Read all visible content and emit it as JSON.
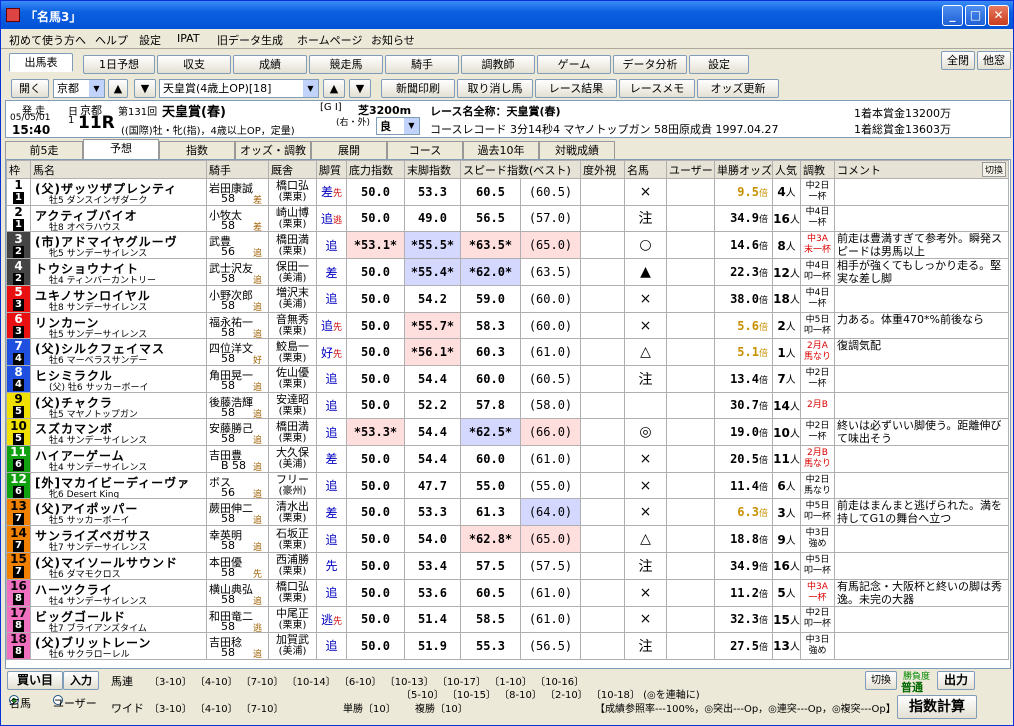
{
  "window": {
    "title": "「名馬3」"
  },
  "menu": [
    "初めて使う方へ",
    "ヘルプ",
    "設定",
    "IPAT",
    "旧データ生成",
    "ホームページ",
    "お知らせ"
  ],
  "main_tabs": [
    "出馬表",
    "1日予想",
    "収支",
    "成績",
    "競走馬",
    "騎手",
    "調教師",
    "ゲーム",
    "データ分析",
    "設定"
  ],
  "right_buttons": [
    "全閉",
    "他窓"
  ],
  "toolbar": {
    "open": "開く",
    "course": "京都",
    "race": "天皇賞(4歳上OP)[18]",
    "buttons": [
      "新聞印刷",
      "取り消し馬",
      "レース結果",
      "レースメモ",
      "オッズ更新"
    ]
  },
  "race_info": {
    "announce": "発 走",
    "date": "05/05/01",
    "time": "15:40",
    "day": "日",
    "place": "京都",
    "day_num": "1",
    "r_num": "11R",
    "kai": "第131回",
    "race_name": "天皇賞(春)",
    "grade": "[G I]",
    "distance": "芝3200m",
    "turn": "(右・外)",
    "going": "良",
    "cond": "((国際)牡・牝(指)，4歳以上OP，定量)",
    "full_label": "レース名全称：天皇賞(春)",
    "record": "コースレコード 3分14秒4 マヤノトップガン 58田原成貴 1997.04.27",
    "prize1": "1着本賞金13200万",
    "prize2": "1着総賞金13603万"
  },
  "sub_tabs": [
    "前5走",
    "予想",
    "指数",
    "オッズ・調教",
    "展開",
    "コース",
    "過去10年",
    "対戦成績"
  ],
  "columns": [
    "枠",
    "馬名",
    "騎手",
    "厩舎",
    "脚質",
    "底力指数",
    "末脚指数",
    "スピード指数(ベスト)",
    "度外視",
    "名馬",
    "ユーザー",
    "単勝オッズ",
    "人気",
    "調教",
    "コメント"
  ],
  "switch_label": "切換",
  "horses": [
    {
      "waku": "1",
      "num": "1",
      "name": "(父)ザッツザプレンティ",
      "sub": "牡5 ダンスインザダーク",
      "jockey": "岩田康誠",
      "weight": "58",
      "jmark": "差",
      "trainer": "橋口弘",
      "region": "(栗東)",
      "leg": "差",
      "legm": "先",
      "base": "50.0",
      "last": "53.3",
      "speed": "60.5",
      "best": "(60.5)",
      "mark": "×",
      "odds": "9.5",
      "oddsGold": true,
      "pop": "4",
      "cond1": "中2日",
      "cond2": "一杯",
      "comment": ""
    },
    {
      "waku": "1",
      "num": "2",
      "name": "アクティブバイオ",
      "sub": "牡8 オペラハウス",
      "jockey": "小牧太",
      "weight": "58",
      "jmark": "差",
      "trainer": "崎山博",
      "region": "(栗東)",
      "leg": "追",
      "legm": "逃",
      "base": "50.0",
      "last": "49.0",
      "speed": "56.5",
      "best": "(57.0)",
      "mark": "注",
      "odds": "34.9",
      "pop": "16",
      "cond1": "中4日",
      "cond2": "一杯",
      "comment": ""
    },
    {
      "waku": "2",
      "num": "3",
      "name": "(市)アドマイヤグルーヴ",
      "sub": "牝5 サンデーサイレンス",
      "jockey": "武豊",
      "weight": "56",
      "jmark": "追",
      "trainer": "橋田満",
      "region": "(栗東)",
      "leg": "追",
      "legm": "",
      "base": "*53.1*",
      "baseHl": "r",
      "last": "*55.5*",
      "lastHl": "b",
      "speed": "*63.5*",
      "speedHl": "r",
      "best": "(65.0)",
      "bestHl": "r",
      "mark": "○",
      "odds": "14.6",
      "pop": "8",
      "cond1": "中3A",
      "cond2": "末一杯",
      "condRed": true,
      "comment": "前走は豊満すぎて参考外。瞬発スピードは男馬以上"
    },
    {
      "waku": "2",
      "num": "4",
      "name": "トウショウナイト",
      "sub": "牡4 ティンバーカントリー",
      "jockey": "武士沢友",
      "weight": "58",
      "jmark": "追",
      "trainer": "保田一",
      "region": "(美浦)",
      "leg": "差",
      "legm": "",
      "base": "50.0",
      "last": "*55.4*",
      "lastHl": "b",
      "speed": "*62.0*",
      "speedHl": "b",
      "best": "(63.5)",
      "mark": "▲",
      "odds": "22.3",
      "pop": "12",
      "cond1": "中4日",
      "cond2": "叩一杯",
      "comment": "相手が強くてもしっかり走る。堅実な差し脚"
    },
    {
      "waku": "3",
      "num": "5",
      "name": "ユキノサンロイヤル",
      "sub": "牡8 サンデーサイレンス",
      "jockey": "小野次郎",
      "weight": "58",
      "jmark": "追",
      "trainer": "増沢末",
      "region": "(美浦)",
      "leg": "追",
      "legm": "",
      "base": "50.0",
      "last": "54.2",
      "speed": "59.0",
      "best": "(60.0)",
      "mark": "×",
      "odds": "38.0",
      "pop": "18",
      "cond1": "中4日",
      "cond2": "一杯",
      "comment": ""
    },
    {
      "waku": "3",
      "num": "6",
      "name": "リンカーン",
      "sub": "牡5 サンデーサイレンス",
      "jockey": "福永祐一",
      "weight": "58",
      "jmark": "追",
      "trainer": "音無秀",
      "region": "(栗東)",
      "leg": "追",
      "legm": "先",
      "base": "50.0",
      "last": "*55.7*",
      "lastHl": "r",
      "speed": "58.3",
      "best": "(60.0)",
      "mark": "×",
      "odds": "5.6",
      "oddsGold": true,
      "pop": "2",
      "cond1": "中5日",
      "cond2": "叩一杯",
      "comment": "力ある。体重470*%前後なら"
    },
    {
      "waku": "4",
      "num": "7",
      "name": "(父)シルクフェイマス",
      "sub": "牡6 マーベラスサンデー",
      "jockey": "四位洋文",
      "weight": "58",
      "jmark": "好",
      "trainer": "鮫島一",
      "region": "(栗東)",
      "leg": "好",
      "legm": "先",
      "base": "50.0",
      "last": "*56.1*",
      "lastHl": "r",
      "speed": "60.3",
      "best": "(61.0)",
      "mark": "△",
      "odds": "5.1",
      "oddsGold": true,
      "pop": "1",
      "cond1": "2月A",
      "cond2": "馬なり",
      "condRed": true,
      "comment": "復調気配"
    },
    {
      "waku": "4",
      "num": "8",
      "name": "ヒシミラクル",
      "sub": "(父) 牡6 サッカーボーイ",
      "jockey": "角田晃一",
      "weight": "58",
      "jmark": "追",
      "trainer": "佐山優",
      "region": "(栗東)",
      "leg": "追",
      "legm": "",
      "base": "50.0",
      "last": "54.4",
      "speed": "60.0",
      "best": "(60.5)",
      "mark": "注",
      "odds": "13.4",
      "pop": "7",
      "cond1": "中2日",
      "cond2": "一杯",
      "comment": ""
    },
    {
      "waku": "5",
      "num": "9",
      "name": "(父)チャクラ",
      "sub": "牡5 マヤノトップガン",
      "jockey": "後藤浩輝",
      "weight": "58",
      "jmark": "追",
      "trainer": "安達昭",
      "region": "(栗東)",
      "leg": "追",
      "legm": "",
      "base": "50.0",
      "last": "52.2",
      "speed": "57.8",
      "best": "(58.0)",
      "mark": "",
      "odds": "30.7",
      "pop": "14",
      "cond1": "2月B",
      "cond2": "",
      "condRed": true,
      "comment": ""
    },
    {
      "waku": "5",
      "num": "10",
      "name": "スズカマンボ",
      "sub": "牡4 サンデーサイレンス",
      "jockey": "安藤勝己",
      "weight": "58",
      "jmark": "追",
      "trainer": "橋田満",
      "region": "(栗東)",
      "leg": "追",
      "legm": "",
      "base": "*53.3*",
      "baseHl": "r",
      "last": "54.4",
      "speed": "*62.5*",
      "speedHl": "b",
      "best": "(66.0)",
      "bestHl": "r",
      "mark": "◎",
      "odds": "19.0",
      "pop": "10",
      "cond1": "中2日",
      "cond2": "一杯",
      "comment": "終いは必ずいい脚使う。距離伸びて味出そう"
    },
    {
      "waku": "6",
      "num": "11",
      "name": "ハイアーゲーム",
      "sub": "牡4 サンデーサイレンス",
      "jockey": "吉田豊",
      "weight": "B 58",
      "jmark": "追",
      "trainer": "大久保",
      "region": "(美浦)",
      "leg": "差",
      "legm": "",
      "base": "50.0",
      "last": "54.4",
      "speed": "60.0",
      "best": "(61.0)",
      "mark": "×",
      "odds": "20.5",
      "pop": "11",
      "cond1": "2月B",
      "cond2": "馬なり",
      "condRed": true,
      "comment": ""
    },
    {
      "waku": "6",
      "num": "12",
      "name": "[外]マカイビーディーヴァ",
      "sub": "牝6 Desert King",
      "jockey": "ボス",
      "weight": "56",
      "jmark": "追",
      "trainer": "フリー",
      "region": "(豪州)",
      "leg": "追",
      "legm": "",
      "base": "50.0",
      "last": "47.7",
      "speed": "55.0",
      "best": "(55.0)",
      "mark": "×",
      "odds": "11.4",
      "pop": "6",
      "cond1": "中2日",
      "cond2": "馬なり",
      "comment": ""
    },
    {
      "waku": "7",
      "num": "13",
      "name": "(父)アイポッパー",
      "sub": "牡5 サッカーボーイ",
      "jockey": "蕨田伸二",
      "weight": "58",
      "jmark": "追",
      "trainer": "清水出",
      "region": "(栗東)",
      "leg": "差",
      "legm": "",
      "base": "50.0",
      "last": "53.3",
      "speed": "61.3",
      "best": "(64.0)",
      "bestHl": "b",
      "mark": "×",
      "odds": "6.3",
      "oddsGold": true,
      "pop": "3",
      "cond1": "中5日",
      "cond2": "叩一杯",
      "comment": "前走はまんまと逃げられた。満を持してG1の舞台へ立つ"
    },
    {
      "waku": "7",
      "num": "14",
      "name": "サンライズペガサス",
      "sub": "牡7 サンデーサイレンス",
      "jockey": "幸英明",
      "weight": "58",
      "jmark": "追",
      "trainer": "石坂正",
      "region": "(栗東)",
      "leg": "追",
      "legm": "",
      "base": "50.0",
      "last": "54.0",
      "speed": "*62.8*",
      "speedHl": "r",
      "best": "(65.0)",
      "bestHl": "r",
      "mark": "△",
      "odds": "18.8",
      "pop": "9",
      "cond1": "中3日",
      "cond2": "強め",
      "comment": ""
    },
    {
      "waku": "7",
      "num": "15",
      "name": "(父)マイソールサウンド",
      "sub": "牡6 ダマモクロス",
      "jockey": "本田優",
      "weight": "58",
      "jmark": "先",
      "trainer": "西浦勝",
      "region": "(栗東)",
      "leg": "先",
      "legm": "",
      "base": "50.0",
      "last": "53.4",
      "speed": "57.5",
      "best": "(57.5)",
      "mark": "注",
      "odds": "34.9",
      "pop": "16",
      "cond1": "中5日",
      "cond2": "叩一杯",
      "comment": ""
    },
    {
      "waku": "8",
      "num": "16",
      "name": "ハーツクライ",
      "sub": "牡4 サンデーサイレンス",
      "jockey": "横山典弘",
      "weight": "58",
      "jmark": "追",
      "trainer": "橋口弘",
      "region": "(栗東)",
      "leg": "追",
      "legm": "",
      "base": "50.0",
      "last": "53.6",
      "speed": "60.5",
      "best": "(61.0)",
      "mark": "×",
      "odds": "11.2",
      "pop": "5",
      "cond1": "中3A",
      "cond2": "一杯",
      "condRed": true,
      "comment": "有馬記念・大阪杯と終いの脚は秀逸。未完の大器"
    },
    {
      "waku": "8",
      "num": "17",
      "name": "ビッグゴールド",
      "sub": "牡7 ブライアンズタイム",
      "jockey": "和田竜二",
      "weight": "58",
      "jmark": "逃",
      "trainer": "中尾正",
      "region": "(栗東)",
      "leg": "逃",
      "legm": "先",
      "base": "50.0",
      "last": "51.4",
      "speed": "58.5",
      "best": "(61.0)",
      "mark": "×",
      "odds": "32.3",
      "pop": "15",
      "cond1": "中2日",
      "cond2": "叩一杯",
      "comment": ""
    },
    {
      "waku": "8",
      "num": "18",
      "name": "(父)ブリットレーン",
      "sub": "牡6 サクラローレル",
      "jockey": "吉田稔",
      "weight": "58",
      "jmark": "追",
      "trainer": "加賀武",
      "region": "(美浦)",
      "leg": "追",
      "legm": "",
      "base": "50.0",
      "last": "51.9",
      "speed": "55.3",
      "best": "(56.5)",
      "mark": "注",
      "odds": "27.5",
      "pop": "13",
      "cond1": "中3日",
      "cond2": "強め",
      "comment": ""
    }
  ],
  "waku_colors": {
    "1": {
      "bg": "#ffffff",
      "fg": "#000"
    },
    "2": {
      "bg": "#444444",
      "fg": "#fff"
    },
    "3": {
      "bg": "#e81010",
      "fg": "#fff"
    },
    "4": {
      "bg": "#2050e0",
      "fg": "#fff"
    },
    "5": {
      "bg": "#f0e000",
      "fg": "#000"
    },
    "6": {
      "bg": "#10a010",
      "fg": "#fff"
    },
    "7": {
      "bg": "#f08000",
      "fg": "#000"
    },
    "8": {
      "bg": "#f070c0",
      "fg": "#000"
    }
  },
  "odds_unit": "倍",
  "pop_unit": "人",
  "bottom": {
    "buy": "買い目",
    "input": "入力",
    "r1": "名馬",
    "r2": "ユーザー",
    "umaren_label": "馬連",
    "umaren1": "〔3-10〕 〔4-10〕 〔7-10〕 〔10-14〕 〔6-10〕 〔10-13〕 〔10-17〕 〔1-10〕 〔10-16〕",
    "umaren2": "〔5-10〕 〔10-15〕 〔8-10〕 〔2-10〕 〔10-18〕 (◎を連軸に)",
    "wide_label": "ワイド",
    "wide": "〔3-10〕 〔4-10〕 〔7-10〕",
    "tansho": "単勝〔10〕",
    "fukusho": "複勝〔10〕",
    "note": "【成績参照率---100%，◎突出---Op，◎連突---Op，◎複突---Op】",
    "switch": "切換",
    "win_deg": "勝負度",
    "win_val": "普通",
    "output": "出力",
    "calc": "指数計算"
  }
}
